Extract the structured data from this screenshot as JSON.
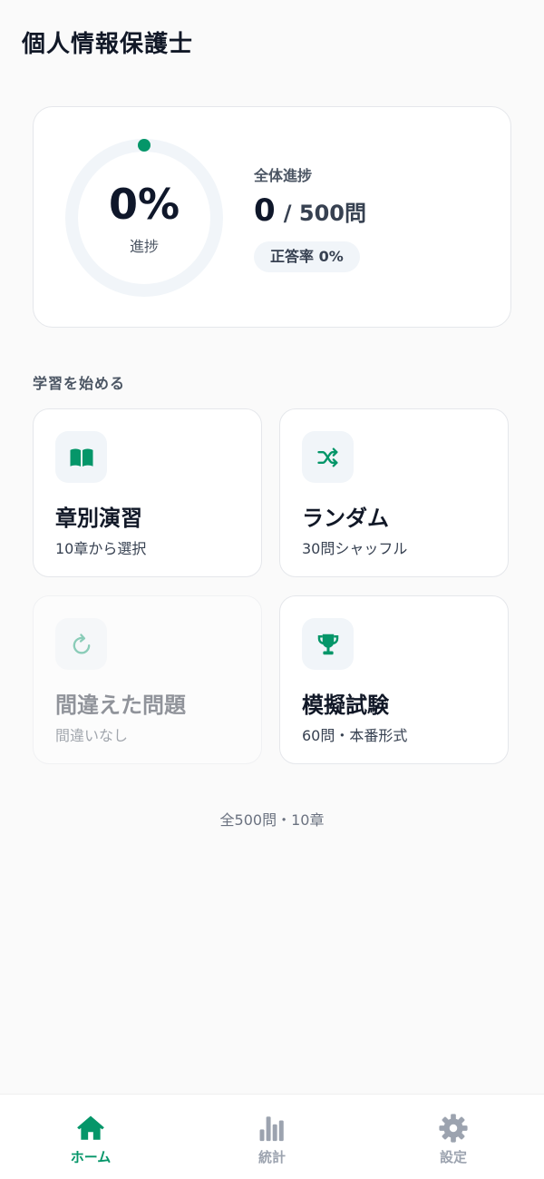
{
  "header": {
    "title": "個人情報保護士"
  },
  "progress": {
    "percent_text": "0%",
    "percent_label": "進捗",
    "fraction": 0,
    "overall_label": "全体進捗",
    "done": "0",
    "total_text": "/ 500問",
    "accuracy_text": "正答率 0%"
  },
  "section": {
    "heading": "学習を始める"
  },
  "cards": [
    {
      "title": "章別演習",
      "subtitle": "10章から選択",
      "icon": "book-icon",
      "enabled": true
    },
    {
      "title": "ランダム",
      "subtitle": "30問シャッフル",
      "icon": "shuffle-icon",
      "enabled": true
    },
    {
      "title": "間違えた問題",
      "subtitle": "間違いなし",
      "icon": "retry-icon",
      "enabled": false
    },
    {
      "title": "模擬試験",
      "subtitle": "60問・本番形式",
      "icon": "trophy-icon",
      "enabled": true
    }
  ],
  "footer": {
    "note": "全500問・10章"
  },
  "nav": [
    {
      "label": "ホーム",
      "icon": "home-icon",
      "active": true
    },
    {
      "label": "統計",
      "icon": "bar-chart-icon",
      "active": false
    },
    {
      "label": "設定",
      "icon": "gear-icon",
      "active": false
    }
  ],
  "colors": {
    "accent": "#059669",
    "inactive": "#9ca3af",
    "ring_track": "#f1f5f9",
    "card_border": "#e5e7eb"
  }
}
